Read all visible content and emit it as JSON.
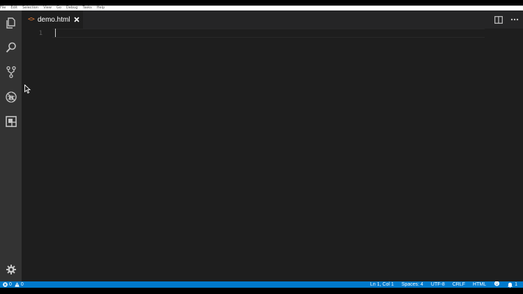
{
  "menubar": {
    "items": [
      "File",
      "Edit",
      "Selection",
      "View",
      "Go",
      "Debug",
      "Tasks",
      "Help"
    ]
  },
  "activitybar": {
    "icons": [
      "explorer-icon",
      "search-icon",
      "source-control-icon",
      "debug-icon",
      "extensions-icon"
    ],
    "bottom_icon": "gear-icon"
  },
  "tabs": [
    {
      "label": "demo.html",
      "icon": "html-file-icon",
      "icon_glyph": "<>",
      "active": true
    }
  ],
  "editor": {
    "line_numbers": [
      "1"
    ]
  },
  "statusbar": {
    "errors": "0",
    "warnings": "0",
    "items": [
      "Ln 1, Col 1",
      "Spaces: 4",
      "UTF-8",
      "CRLF",
      "HTML"
    ],
    "notifications": "1"
  },
  "colors": {
    "activitybar": "#333333",
    "editor_bg": "#1e1e1e",
    "tabstrip_bg": "#252526",
    "statusbar": "#007acc",
    "html_icon": "#e37933"
  }
}
